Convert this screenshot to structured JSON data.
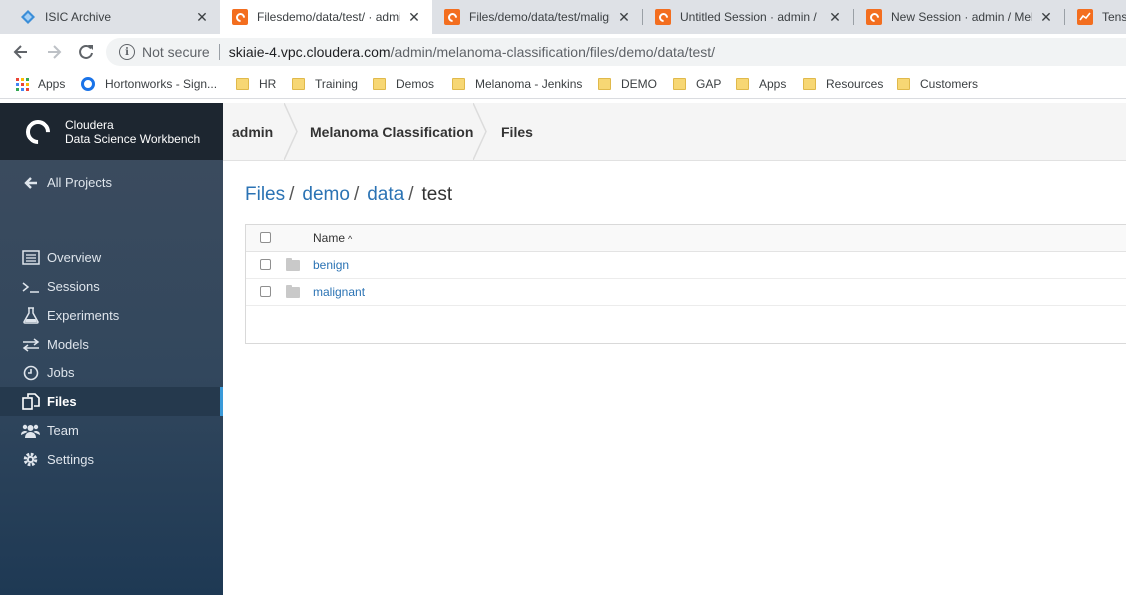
{
  "browser": {
    "tabs": [
      {
        "title": "ISIC Archive",
        "icon": "isic-icon",
        "active": false
      },
      {
        "title": "Filesdemo/data/test/ · admin",
        "icon": "cloudera-icon",
        "active": true
      },
      {
        "title": "Files/demo/data/test/malignant",
        "icon": "cloudera-icon",
        "active": false
      },
      {
        "title": "Untitled Session · admin / Melanoma",
        "icon": "cloudera-icon",
        "active": false
      },
      {
        "title": "New Session · admin / Melanoma",
        "icon": "cloudera-icon",
        "active": false
      },
      {
        "title": "Tenso",
        "icon": "tensorboard-icon",
        "active": false
      }
    ],
    "security_label": "Not secure",
    "url_host": "skiaie-4.vpc.cloudera.com",
    "url_path": "/admin/melanoma-classification/files/demo/data/test/",
    "bookmarks": [
      {
        "label": "Apps",
        "icon": "apps-grid-icon"
      },
      {
        "label": "Hortonworks - Sign...",
        "icon": "hortonworks-icon"
      },
      {
        "label": "HR",
        "icon": "folder-icon"
      },
      {
        "label": "Training",
        "icon": "folder-icon"
      },
      {
        "label": "Demos",
        "icon": "folder-icon"
      },
      {
        "label": "Melanoma - Jenkins",
        "icon": "folder-icon"
      },
      {
        "label": "DEMO",
        "icon": "folder-icon"
      },
      {
        "label": "GAP",
        "icon": "folder-icon"
      },
      {
        "label": "Apps",
        "icon": "folder-icon"
      },
      {
        "label": "Resources",
        "icon": "folder-icon"
      },
      {
        "label": "Customers",
        "icon": "folder-icon"
      }
    ]
  },
  "brand": {
    "line1": "Cloudera",
    "line2": "Data Science Workbench"
  },
  "sidebar": {
    "back_label": "All Projects",
    "items": [
      {
        "label": "Overview",
        "icon": "overview-icon",
        "active": false
      },
      {
        "label": "Sessions",
        "icon": "terminal-icon",
        "active": false
      },
      {
        "label": "Experiments",
        "icon": "flask-icon",
        "active": false
      },
      {
        "label": "Models",
        "icon": "arrows-icon",
        "active": false
      },
      {
        "label": "Jobs",
        "icon": "clock-icon",
        "active": false
      },
      {
        "label": "Files",
        "icon": "files-icon",
        "active": true
      },
      {
        "label": "Team",
        "icon": "team-icon",
        "active": false
      },
      {
        "label": "Settings",
        "icon": "gear-icon",
        "active": false
      }
    ]
  },
  "header": {
    "crumbs": [
      "admin",
      "Melanoma Classification",
      "Files"
    ]
  },
  "path": {
    "links": [
      "Files",
      "demo",
      "data"
    ],
    "current": "test"
  },
  "table": {
    "name_header": "Name",
    "sort_icon": "sort-asc-icon",
    "rows": [
      {
        "name": "benign",
        "icon": "folder-icon"
      },
      {
        "name": "malignant",
        "icon": "folder-icon"
      }
    ]
  },
  "colors": {
    "accent": "#2b73b4",
    "tab_favicon": "#f36e1f",
    "sidebar_active_bar": "#3a9ad9"
  }
}
